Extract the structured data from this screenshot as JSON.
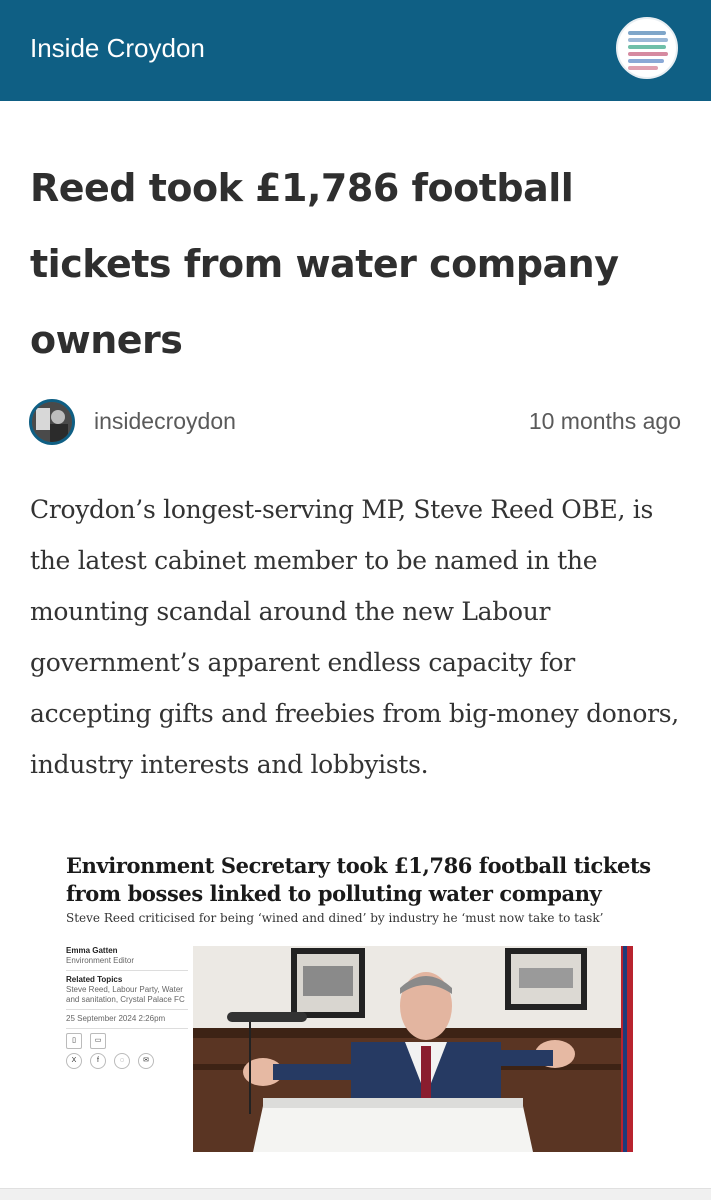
{
  "header": {
    "site_title": "Inside Croydon",
    "logo_icon": "site-logo-icon",
    "brand_color": "#0f5f84"
  },
  "article": {
    "headline": "Reed took £1,786 football tickets from water company owners",
    "author": "insidecroydon",
    "time_ago": "10 months ago",
    "lede": "Croydon’s longest-serving MP, Steve Reed OBE, is the latest cabinet member to be named in the mounting scandal around the new Labour government’s apparent endless capacity for accepting gifts and freebies from big-money donors, industry interests and lobbyists."
  },
  "embed": {
    "title": "Environment Secretary took £1,786 football tickets from bosses linked to polluting water company",
    "subtitle": "Steve Reed criticised for being ‘wined and dined’ by industry he ‘must now take to task’",
    "byline_name": "Emma Gatten",
    "byline_role": "Environment Editor",
    "related_label": "Related Topics",
    "related_topics": "Steve Reed, Labour Party, Water and sanitation, Crystal Palace FC",
    "date": "25 September 2024 2:26pm",
    "share_icons": [
      "bookmark-icon",
      "comment-icon",
      "x-icon",
      "facebook-icon",
      "whatsapp-icon",
      "email-icon"
    ]
  }
}
